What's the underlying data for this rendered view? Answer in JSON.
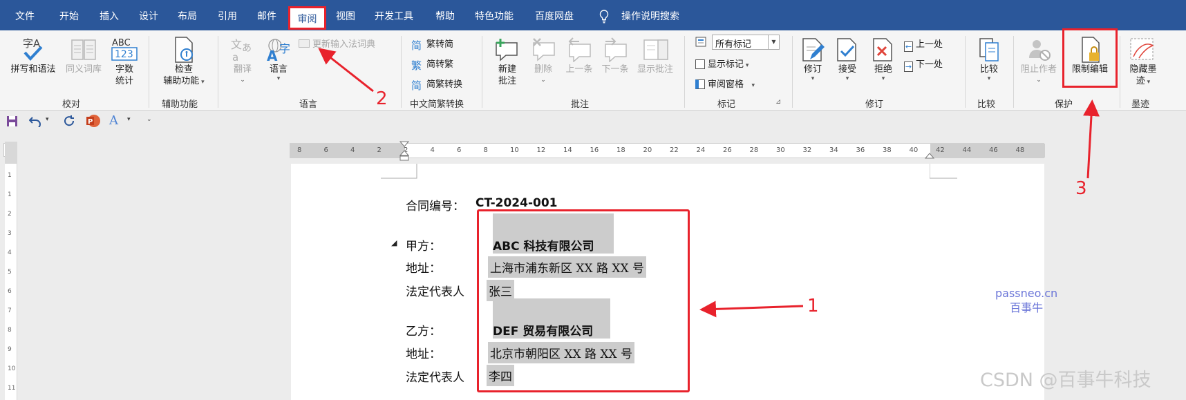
{
  "menu": {
    "tabs": [
      "文件",
      "开始",
      "插入",
      "设计",
      "布局",
      "引用",
      "邮件",
      "审阅",
      "视图",
      "开发工具",
      "帮助",
      "特色功能",
      "百度网盘"
    ],
    "tell_me": "操作说明搜索"
  },
  "ribbon": {
    "proofing": {
      "spelling": "拼写和语法",
      "thesaurus": "同义词库",
      "word_count_line1": "字数",
      "word_count_line2": "统计",
      "label": "校对"
    },
    "accessibility": {
      "check_line1": "检查",
      "check_line2": "辅助功能",
      "label": "辅助功能"
    },
    "language": {
      "translate": "翻译",
      "language": "语言",
      "update_ime": "更新输入法词典",
      "label": "语言"
    },
    "chinese": {
      "to_simplified": "繁转简",
      "to_traditional": "简转繁",
      "convert": "简繁转换",
      "label": "中文简繁转换"
    },
    "comments": {
      "new_line1": "新建",
      "new_line2": "批注",
      "delete": "删除",
      "previous": "上一条",
      "next": "下一条",
      "show": "显示批注",
      "label": "批注"
    },
    "tracking": {
      "markup_select": "所有标记",
      "show_markup": "显示标记",
      "reviewing_pane": "审阅窗格",
      "label": "标记"
    },
    "changes": {
      "track": "修订",
      "accept": "接受",
      "reject": "拒绝",
      "prev": "上一处",
      "next": "下一处",
      "label": "修订"
    },
    "compare": {
      "compare": "比较",
      "label": "比较"
    },
    "protect": {
      "block_authors": "阻止作者",
      "restrict": "限制编辑",
      "label": "保护"
    },
    "ink": {
      "hide_line1": "隐藏墨",
      "hide_line2": "迹",
      "label": "墨迹"
    }
  },
  "ruler": {
    "labels": [
      "8",
      "6",
      "4",
      "2",
      "2",
      "4",
      "6",
      "8",
      "10",
      "12",
      "14",
      "16",
      "18",
      "20",
      "22",
      "24",
      "26",
      "28",
      "30",
      "32",
      "34",
      "36",
      "38",
      "40",
      "42",
      "44",
      "46",
      "48"
    ],
    "vertical_labels": [
      "1",
      "1",
      "2",
      "3",
      "4",
      "5",
      "6",
      "7",
      "8",
      "9",
      "10",
      "11"
    ]
  },
  "document": {
    "contract_label": "合同编号：",
    "contract_no": "CT-2024-001",
    "party_a_label": "甲方：",
    "party_a_name": "ABC 科技有限公司",
    "address_label_a": "地址：",
    "party_a_address": "上海市浦东新区 XX 路 XX 号",
    "rep_label_a": "法定代表人",
    "party_a_rep": "张三",
    "party_b_label": "乙方：",
    "party_b_name": "DEF 贸易有限公司",
    "address_label_b": "地址：",
    "party_b_address": "北京市朝阳区 XX 路 XX 号",
    "rep_label_b": "法定代表人",
    "party_b_rep": "李四"
  },
  "annotations": {
    "one": "1",
    "two": "2",
    "three": "3"
  },
  "watermark": {
    "line1": "passneo.cn",
    "line2": "百事牛"
  },
  "credit": "CSDN @百事牛科技",
  "colors": {
    "menu_bar": "#2b579a",
    "annotation_red": "#e8222c",
    "highlight": "#cccccc",
    "watermark": "#6a75d8"
  }
}
